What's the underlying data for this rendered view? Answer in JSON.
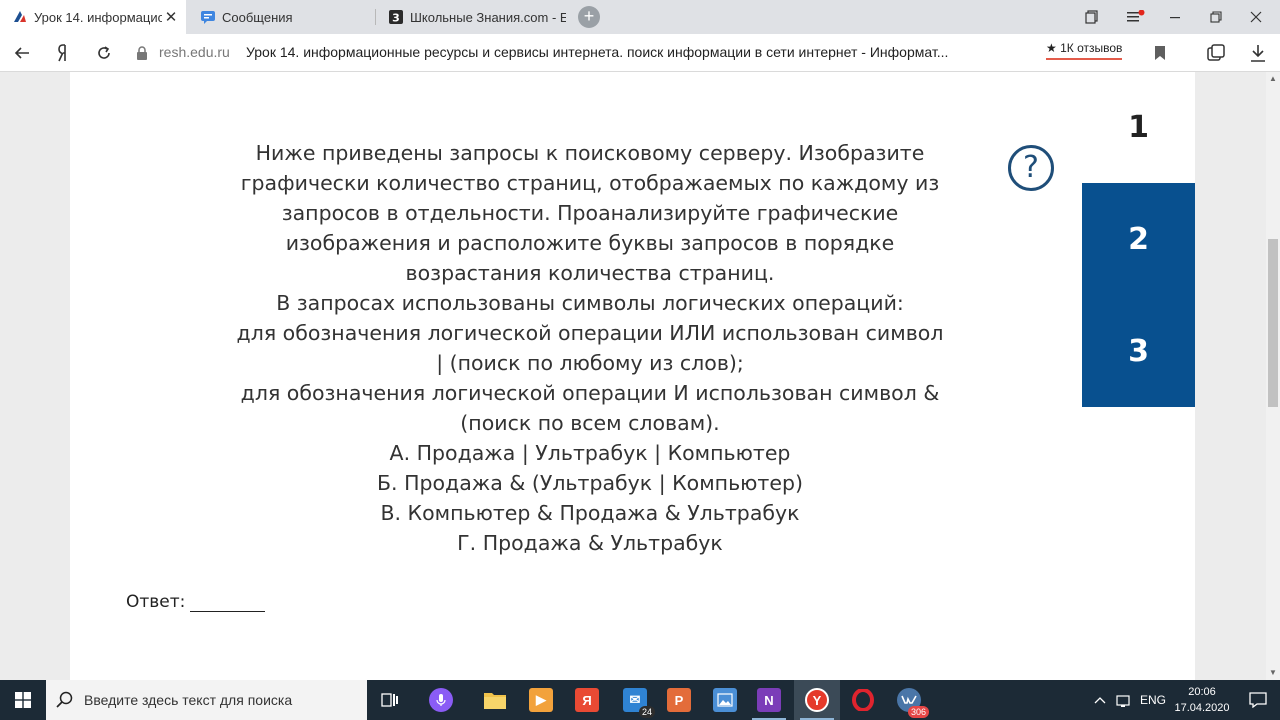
{
  "browser": {
    "tabs": [
      {
        "title": "Урок 14. информацион",
        "close": "✕"
      },
      {
        "title": "Сообщения"
      },
      {
        "title": "Школьные Знания.com - Е"
      }
    ],
    "new_tab": "+",
    "address": {
      "domain": "resh.edu.ru",
      "title": "Урок 14. информационные ресурсы и сервисы интернета. поиск информации в сети интернет - Информат...",
      "reviews": "★ 1К отзывов"
    }
  },
  "page": {
    "task_lines": [
      "Ниже приведены запросы к поисковому серверу. Изобразите графически количество страниц, отображаемых по каждому из запросов в отдельности. Проанализируйте графические изображения и расположите буквы запросов в порядке возрастания количества страниц.",
      "В запросах использованы символы логических операций:",
      "для обозначения логической операции ИЛИ использован символ | (поиск по любому из слов);",
      "для обозначения логической операции И использован символ & (поиск по всем словам).",
      "А. Продажа | Ультрабук | Компьютер",
      "Б. Продажа & (Ультрабук | Компьютер)",
      "В. Компьютер & Продажа & Ультрабук",
      "Г. Продажа & Ультрабук"
    ],
    "help": "?",
    "question_nav": [
      "1",
      "2",
      "3"
    ],
    "answer_label": "Ответ:"
  },
  "taskbar": {
    "search_placeholder": "Введите здесь текст для поиска",
    "mail_badge": "24",
    "vk_badge": "306",
    "language": "ENG",
    "time": "20:06",
    "date": "17.04.2020"
  },
  "colors": {
    "nav_active": "#08508f",
    "help_icon": "#1f4e79",
    "taskbar": "#1c2a36"
  }
}
